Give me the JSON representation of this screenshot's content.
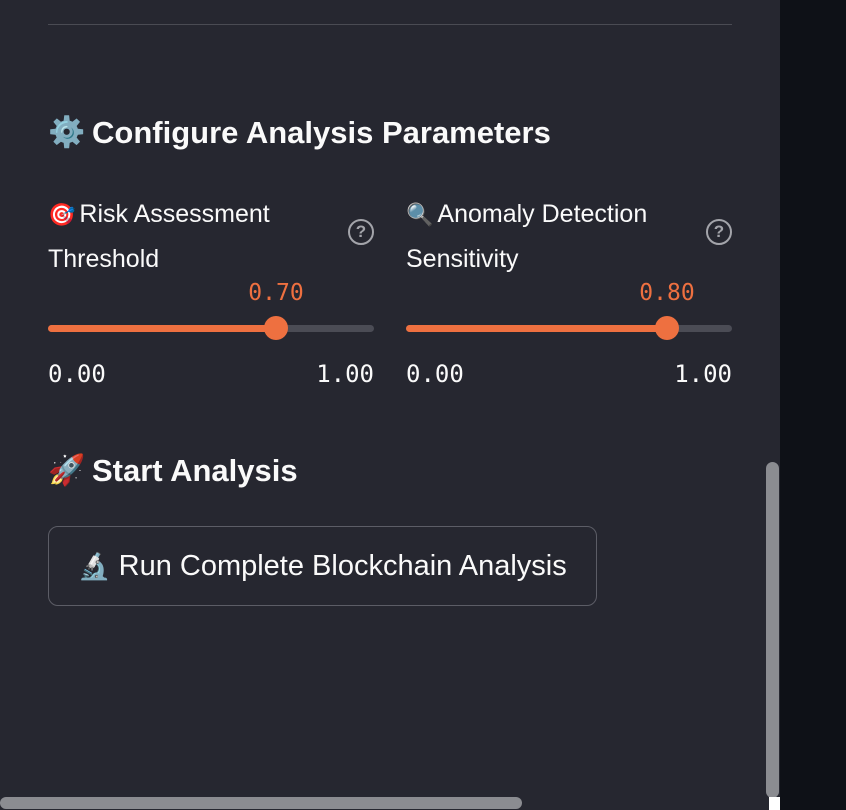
{
  "config_section": {
    "icon": "gear-icon",
    "title_emoji": "⚙️",
    "title": "Configure Analysis Parameters"
  },
  "sliders": [
    {
      "icon": "target-icon",
      "emoji": "🎯",
      "label": "Risk Assessment Threshold",
      "value_text": "0.70",
      "value": 0.7,
      "min_text": "0.00",
      "max_text": "1.00",
      "min": 0.0,
      "max": 1.0,
      "help_glyph": "?"
    },
    {
      "icon": "magnifier-icon",
      "emoji": "🔍",
      "label": "Anomaly Detection Sensitivity",
      "value_text": "0.80",
      "value": 0.8,
      "min_text": "0.00",
      "max_text": "1.00",
      "min": 0.0,
      "max": 1.0,
      "help_glyph": "?"
    }
  ],
  "start_section": {
    "icon": "rocket-icon",
    "title_emoji": "🚀",
    "title": "Start Analysis"
  },
  "run_button": {
    "icon": "microscope-icon",
    "emoji": "🔬",
    "label": "Run Complete Blockchain Analysis"
  },
  "colors": {
    "accent": "#ee7040",
    "sidebar_bg": "#262730",
    "track": "#4b4c55",
    "text": "#fafafa"
  }
}
